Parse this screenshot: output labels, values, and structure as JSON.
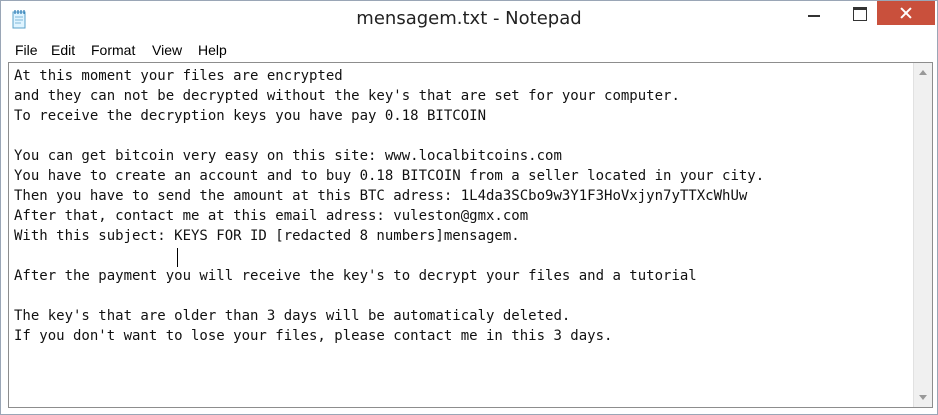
{
  "window": {
    "title": "mensagem.txt - Notepad"
  },
  "menu": {
    "items": [
      "File",
      "Edit",
      "Format",
      "View",
      "Help"
    ]
  },
  "document": {
    "text": "At this moment your files are encrypted\nand they can not be decrypted without the key's that are set for your computer.\nTo receive the decryption keys you have pay 0.18 BITCOIN\n\nYou can get bitcoin very easy on this site: www.localbitcoins.com\nYou have to create an account and to buy 0.18 BITCOIN from a seller located in your city.\nThen you have to send the amount at this BTC adress: 1L4da3SCbo9w3Y1F3HoVxjyn7yTTXcWhUw\nAfter that, contact me at this email adress: vuleston@gmx.com\nWith this subject: KEYS FOR ID [redacted 8 numbers]mensagem.\n\nAfter the payment you will receive the key's to decrypt your files and a tutorial\n\nThe key's that are older than 3 days will be automaticaly deleted.\nIf you don't want to lose your files, please contact me in this 3 days."
  },
  "icons": {
    "app": "notepad-icon",
    "minimize": "minimize-icon",
    "maximize": "maximize-icon",
    "close": "close-icon"
  },
  "colors": {
    "close_button": "#c9503c",
    "window_border": "#9aa6b6"
  }
}
